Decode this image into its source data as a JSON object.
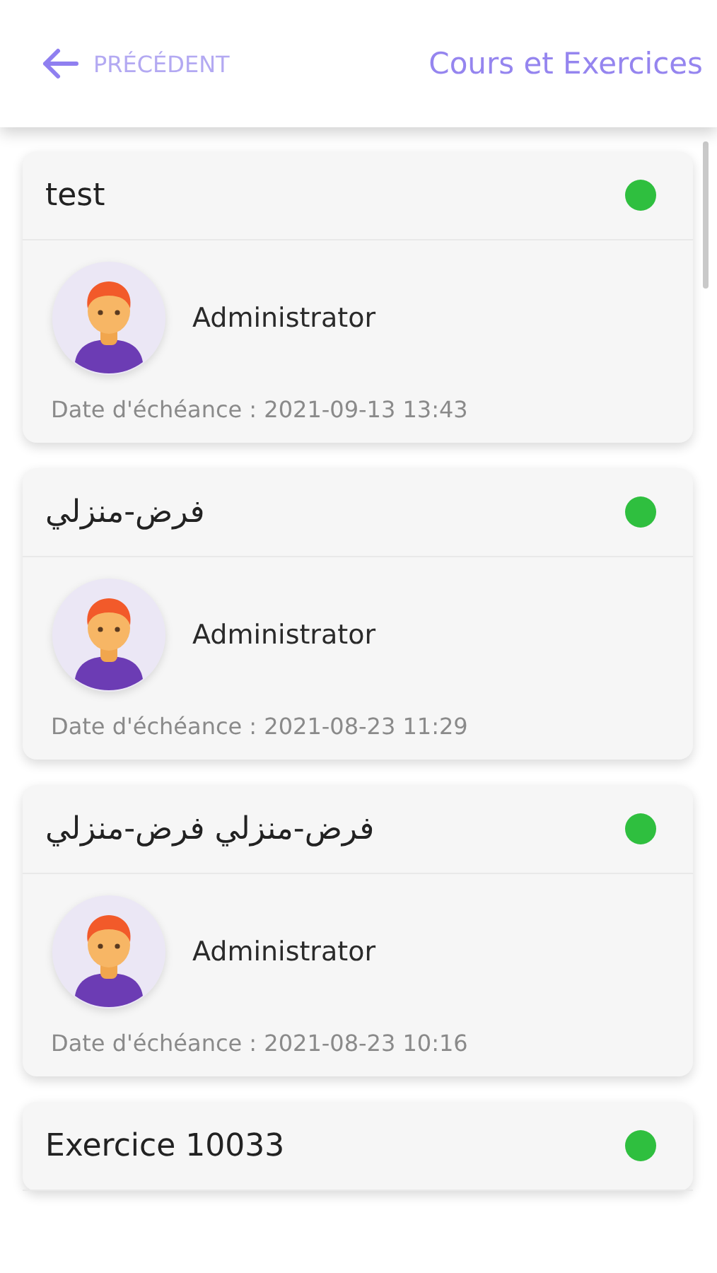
{
  "header": {
    "back_label": "PRÉCÉDENT",
    "title": "Cours et Exercices"
  },
  "items": [
    {
      "title": "test",
      "color": "#2fbf3f",
      "author": "Administrator",
      "due": "Date d'échéance : 2021-09-13 13:43"
    },
    {
      "title": "فرض-منزلي",
      "color": "#2fbf3f",
      "author": "Administrator",
      "due": "Date d'échéance : 2021-08-23 11:29"
    },
    {
      "title": "فرض-منزلي فرض-منزلي",
      "color": "#2fbf3f",
      "author": "Administrator",
      "due": "Date d'échéance : 2021-08-23 10:16"
    },
    {
      "title": "Exercice 10033",
      "color": "#2fbf3f"
    }
  ]
}
